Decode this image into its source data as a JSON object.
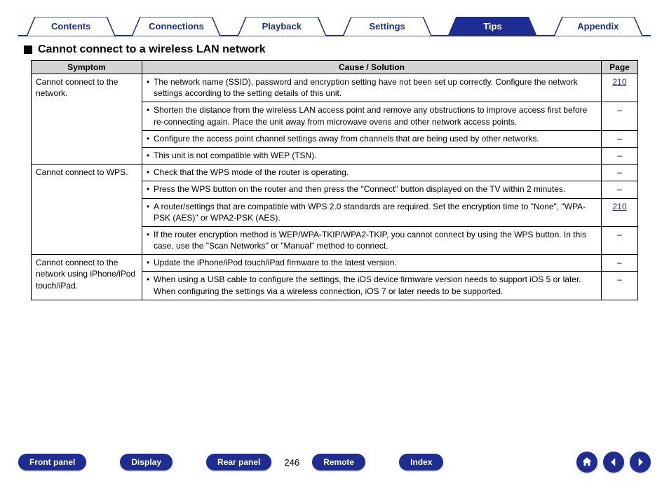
{
  "tabs": {
    "contents": "Contents",
    "connections": "Connections",
    "playback": "Playback",
    "settings": "Settings",
    "tips": "Tips",
    "appendix": "Appendix"
  },
  "section": {
    "title": "Cannot connect to a wireless LAN network"
  },
  "table": {
    "headers": {
      "symptom": "Symptom",
      "cause": "Cause / Solution",
      "page": "Page"
    },
    "groups": [
      {
        "symptom": "Cannot connect to the network.",
        "rows": [
          {
            "text": "The network name (SSID), password and encryption setting have not been set up correctly. Configure the network settings according to the setting details of this unit.",
            "page": "210",
            "link": true
          },
          {
            "text": "Shorten the distance from the wireless LAN access point and remove any obstructions to improve access first before re-connecting again. Place the unit away from microwave ovens and other network access points.",
            "page": "–"
          },
          {
            "text": "Configure the access point channel settings away from channels that are being used by other networks.",
            "page": "–"
          },
          {
            "text": "This unit is not compatible with WEP (TSN).",
            "page": "–"
          }
        ]
      },
      {
        "symptom": "Cannot connect to WPS.",
        "rows": [
          {
            "text": "Check that the WPS mode of the router is operating.",
            "page": "–"
          },
          {
            "text": "Press the WPS button on the router and then press the \"Connect\" button displayed on the TV within 2 minutes.",
            "page": "–"
          },
          {
            "text": "A router/settings that are compatible with WPS 2.0 standards are required. Set the encryption time to \"None\", \"WPA-PSK (AES)\" or WPA2-PSK (AES).",
            "page": "210",
            "link": true
          },
          {
            "text": "If the router encryption method is WEP/WPA-TKIP/WPA2-TKIP, you cannot connect by using the WPS button. In this case, use the \"Scan Networks\" or \"Manual\" method to connect.",
            "page": "–"
          }
        ]
      },
      {
        "symptom": "Cannot connect to the network using iPhone/iPod touch/iPad.",
        "rows": [
          {
            "text": "Update the iPhone/iPod touch/iPad firmware to the latest version.",
            "page": "–"
          },
          {
            "text": "When using a USB cable to configure the settings, the iOS device firmware version needs to support iOS 5 or later. When configuring the settings via a wireless connection, iOS 7 or later needs to be supported.",
            "page": "–"
          }
        ]
      }
    ]
  },
  "bottom": {
    "front_panel": "Front panel",
    "display": "Display",
    "rear_panel": "Rear panel",
    "remote": "Remote",
    "index": "Index",
    "page_number": "246"
  }
}
